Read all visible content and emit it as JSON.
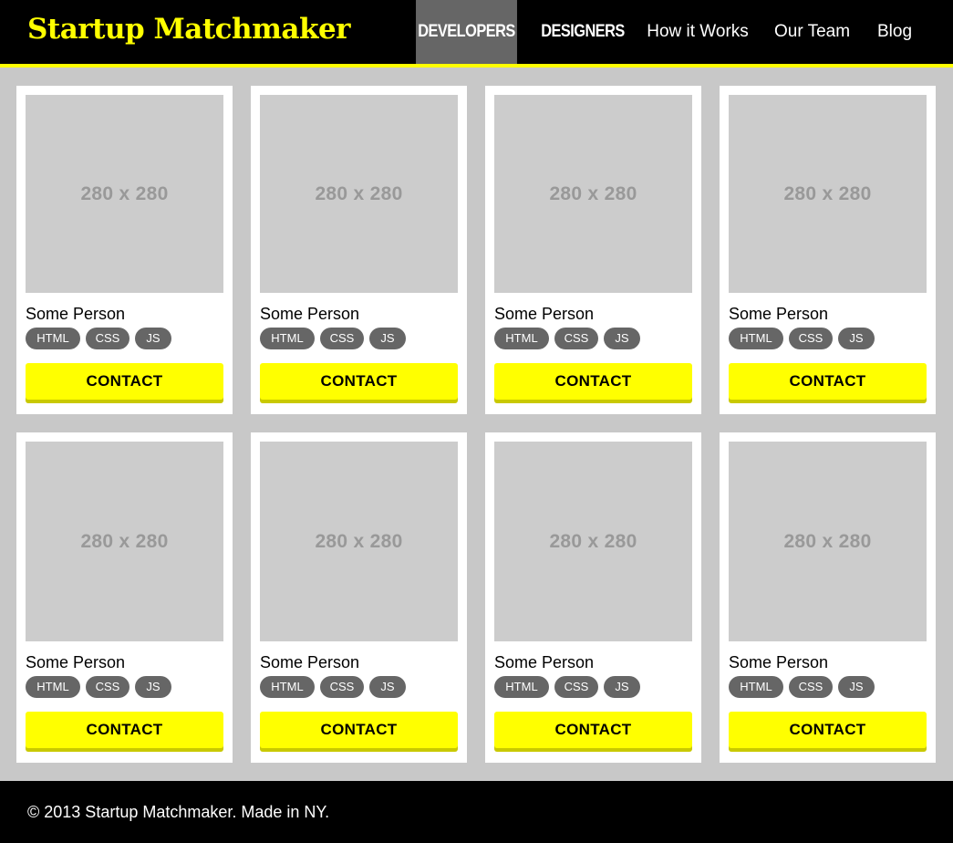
{
  "header": {
    "brand": "Startup Matchmaker",
    "nav": [
      {
        "label": "DEVELOPERS",
        "active": true
      },
      {
        "label": "DESIGNERS",
        "active": false
      },
      {
        "label": "How it Works",
        "active": false
      },
      {
        "label": "Our Team",
        "active": false
      },
      {
        "label": "Blog",
        "active": false
      }
    ]
  },
  "cards": [
    {
      "photo": "280 x 280",
      "name": "Some Person",
      "tags": [
        "HTML",
        "CSS",
        "JS"
      ],
      "button": "CONTACT"
    },
    {
      "photo": "280 x 280",
      "name": "Some Person",
      "tags": [
        "HTML",
        "CSS",
        "JS"
      ],
      "button": "CONTACT"
    },
    {
      "photo": "280 x 280",
      "name": "Some Person",
      "tags": [
        "HTML",
        "CSS",
        "JS"
      ],
      "button": "CONTACT"
    },
    {
      "photo": "280 x 280",
      "name": "Some Person",
      "tags": [
        "HTML",
        "CSS",
        "JS"
      ],
      "button": "CONTACT"
    },
    {
      "photo": "280 x 280",
      "name": "Some Person",
      "tags": [
        "HTML",
        "CSS",
        "JS"
      ],
      "button": "CONTACT"
    },
    {
      "photo": "280 x 280",
      "name": "Some Person",
      "tags": [
        "HTML",
        "CSS",
        "JS"
      ],
      "button": "CONTACT"
    },
    {
      "photo": "280 x 280",
      "name": "Some Person",
      "tags": [
        "HTML",
        "CSS",
        "JS"
      ],
      "button": "CONTACT"
    },
    {
      "photo": "280 x 280",
      "name": "Some Person",
      "tags": [
        "HTML",
        "CSS",
        "JS"
      ],
      "button": "CONTACT"
    }
  ],
  "footer": {
    "text": "© 2013 Startup Matchmaker. Made in NY."
  },
  "colors": {
    "accent": "#ffff00",
    "header_bg": "#000000",
    "active_nav_bg": "#666666",
    "page_bg": "#c8c8c8",
    "placeholder_bg": "#cccccc",
    "tag_bg": "#666666"
  }
}
